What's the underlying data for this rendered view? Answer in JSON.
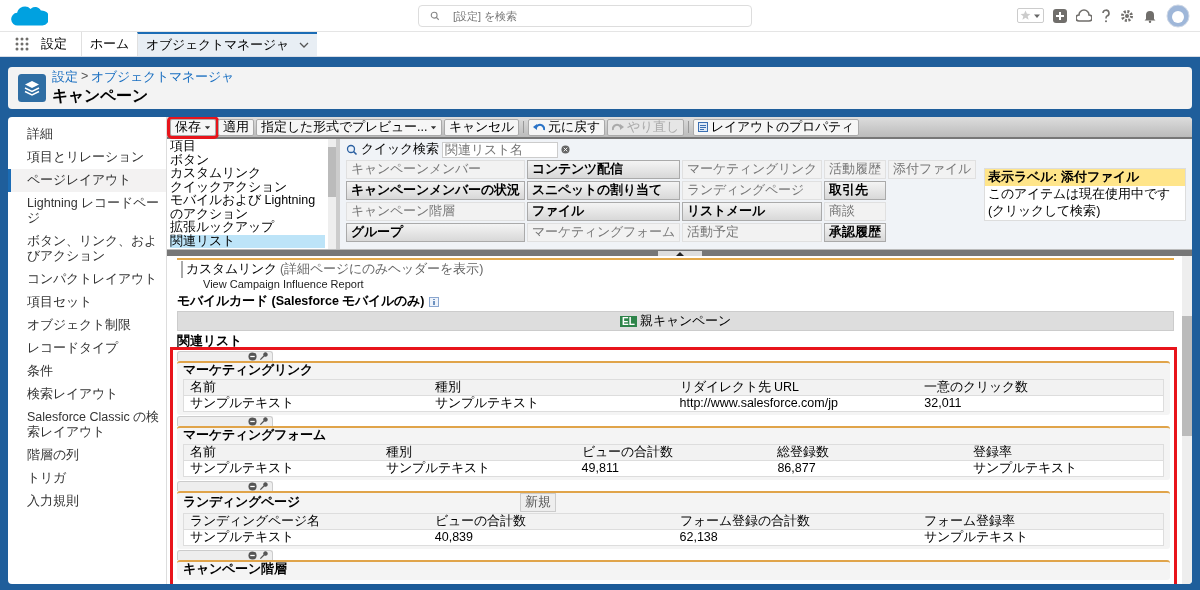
{
  "header": {
    "search_placeholder": "[設定] を検索"
  },
  "nav": {
    "app_name": "設定",
    "tabs": [
      {
        "label": "ホーム",
        "selected": false
      },
      {
        "label": "オブジェクトマネージャ",
        "selected": true
      }
    ]
  },
  "page_header": {
    "breadcrumb": [
      "設定",
      "オブジェクトマネージャ"
    ],
    "separator": ">",
    "title": "キャンペーン"
  },
  "sidebar": {
    "items": [
      {
        "label": "詳細",
        "selected": false
      },
      {
        "label": "項目とリレーション",
        "selected": false
      },
      {
        "label": "ページレイアウト",
        "selected": true
      },
      {
        "label": "Lightning レコードページ",
        "selected": false
      },
      {
        "label": "ボタン、リンク、およびアクション",
        "selected": false
      },
      {
        "label": "コンパクトレイアウト",
        "selected": false
      },
      {
        "label": "項目セット",
        "selected": false
      },
      {
        "label": "オブジェクト制限",
        "selected": false
      },
      {
        "label": "レコードタイプ",
        "selected": false
      },
      {
        "label": "条件",
        "selected": false
      },
      {
        "label": "検索レイアウト",
        "selected": false
      },
      {
        "label": "Salesforce Classic の検索レイアウト",
        "selected": false
      },
      {
        "label": "階層の列",
        "selected": false
      },
      {
        "label": "トリガ",
        "selected": false
      },
      {
        "label": "入力規則",
        "selected": false
      }
    ]
  },
  "toolbar": {
    "buttons": [
      {
        "kind": "menu",
        "label": "保存",
        "disabled": false,
        "highlighted": true
      },
      {
        "kind": "plain",
        "label": "適用",
        "disabled": false,
        "highlighted": false
      },
      {
        "kind": "menu",
        "label": "指定した形式でプレビュー...",
        "disabled": false,
        "highlighted": false
      },
      {
        "kind": "plain",
        "label": "キャンセル",
        "disabled": false,
        "highlighted": false
      },
      {
        "kind": "undo",
        "label": "元に戻す",
        "disabled": false,
        "highlighted": false
      },
      {
        "kind": "redo",
        "label": "やり直し",
        "disabled": true,
        "highlighted": false
      },
      {
        "kind": "properties",
        "label": "レイアウトのプロパティ",
        "disabled": false,
        "highlighted": false
      }
    ]
  },
  "palette": {
    "categories": [
      {
        "label": "項目",
        "selected": false
      },
      {
        "label": "ボタン",
        "selected": false
      },
      {
        "label": "カスタムリンク",
        "selected": false
      },
      {
        "label": "クイックアクション",
        "selected": false
      },
      {
        "label": "モバイルおよび Lightning のアクション",
        "selected": false
      },
      {
        "label": "拡張ルックアップ",
        "selected": false
      },
      {
        "label": "関連リスト",
        "selected": true
      }
    ],
    "quick_find_label": "クイック検索",
    "quick_find_placeholder": "関連リスト名",
    "columns": [
      [
        {
          "label": "キャンペーンメンバー",
          "in_use": true
        },
        {
          "label": "キャンペーンメンバーの状況",
          "in_use": false
        },
        {
          "label": "キャンペーン階層",
          "in_use": true
        },
        {
          "label": "グループ",
          "in_use": false
        }
      ],
      [
        {
          "label": "コンテンツ配信",
          "in_use": false
        },
        {
          "label": "スニペットの割り当て",
          "in_use": false
        },
        {
          "label": "ファイル",
          "in_use": false
        },
        {
          "label": "マーケティングフォーム",
          "in_use": true
        }
      ],
      [
        {
          "label": "マーケティングリンク",
          "in_use": true
        },
        {
          "label": "ランディングページ",
          "in_use": true
        },
        {
          "label": "リストメール",
          "in_use": false
        },
        {
          "label": "活動予定",
          "in_use": true
        }
      ],
      [
        {
          "label": "活動履歴",
          "in_use": true
        },
        {
          "label": "取引先",
          "in_use": false
        },
        {
          "label": "商談",
          "in_use": true
        },
        {
          "label": "承認履歴",
          "in_use": false
        }
      ],
      [
        {
          "label": "添付ファイル",
          "in_use": true
        }
      ]
    ],
    "tooltip": {
      "title": "表示ラベル: 添付ファイル",
      "text": "このアイテムは現在使用中です (クリックして検索)"
    }
  },
  "custom_links": {
    "title": "カスタムリンク",
    "note": "(詳細ページにのみヘッダーを表示)",
    "links": [
      "View Campaign Influence Report"
    ]
  },
  "mobile_cards": {
    "title": "モバイルカード (Salesforce モバイルのみ)",
    "cards": [
      {
        "badge": "EL",
        "label": "親キャンペーン"
      }
    ]
  },
  "related_lists_title": "関連リスト",
  "related_lists_highlighted": true,
  "related_lists": [
    {
      "title": "マーケティングリンク",
      "columns": [
        "名前",
        "種別",
        "リダイレクト先 URL",
        "一意のクリック数"
      ],
      "row": [
        "サンプルテキスト",
        "サンプルテキスト",
        "http://www.salesforce.com/jp",
        "32,011"
      ]
    },
    {
      "title": "マーケティングフォーム",
      "columns": [
        "名前",
        "種別",
        "ビューの合計数",
        "総登録数",
        "登録率"
      ],
      "row": [
        "サンプルテキスト",
        "サンプルテキスト",
        "49,811",
        "86,877",
        "サンプルテキスト"
      ]
    },
    {
      "title": "ランディングページ",
      "new_button": "新規",
      "columns": [
        "ランディングページ名",
        "ビューの合計数",
        "フォーム登録の合計数",
        "フォーム登録率"
      ],
      "row": [
        "サンプルテキスト",
        "40,839",
        "62,138",
        "サンプルテキスト"
      ]
    },
    {
      "title": "キャンペーン階層"
    }
  ]
}
